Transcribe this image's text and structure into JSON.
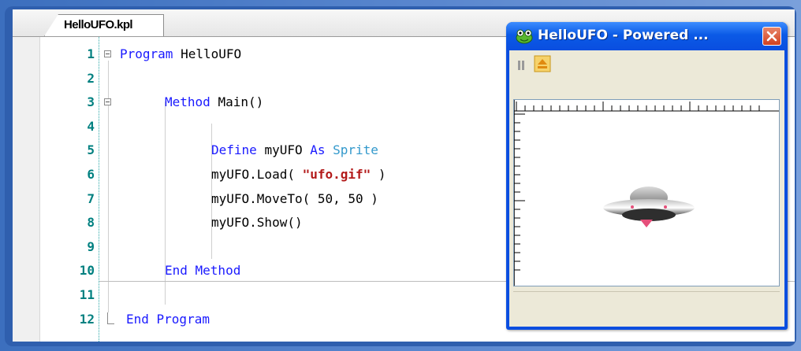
{
  "editor": {
    "tab_label": "HelloUFO.kpl",
    "lines": [
      {
        "num": "1",
        "tokens": [
          [
            "kw",
            "Program "
          ],
          [
            "tx",
            "HelloUFO"
          ]
        ]
      },
      {
        "num": "2",
        "tokens": []
      },
      {
        "num": "3",
        "tokens": [
          [
            "kw",
            "Method "
          ],
          [
            "tx",
            "Main()"
          ]
        ]
      },
      {
        "num": "4",
        "tokens": []
      },
      {
        "num": "5",
        "tokens": [
          [
            "kw",
            "Define "
          ],
          [
            "tx",
            "myUFO "
          ],
          [
            "kw",
            "As "
          ],
          [
            "ty",
            "Sprite"
          ]
        ]
      },
      {
        "num": "6",
        "tokens": [
          [
            "tx",
            "myUFO.Load( "
          ],
          [
            "str",
            "\"ufo.gif\""
          ],
          [
            "tx",
            " )"
          ]
        ]
      },
      {
        "num": "7",
        "tokens": [
          [
            "tx",
            "myUFO.MoveTo( 50, 50 )"
          ]
        ]
      },
      {
        "num": "8",
        "tokens": [
          [
            "tx",
            "myUFO.Show()"
          ]
        ]
      },
      {
        "num": "9",
        "tokens": []
      },
      {
        "num": "10",
        "tokens": [
          [
            "kw",
            "End Method"
          ]
        ]
      },
      {
        "num": "11",
        "tokens": []
      },
      {
        "num": "12",
        "tokens": [
          [
            "kw",
            "End Program"
          ]
        ]
      }
    ]
  },
  "window": {
    "title": "HelloUFO - Powered ...",
    "icons": [
      "frog-icon",
      "close-icon",
      "pause-icon",
      "eject-icon"
    ]
  },
  "colors": {
    "keyword": "#1a1aff",
    "string": "#b31a1a",
    "type": "#3399cc",
    "line_number": "#008080",
    "titlebar": "#0a4ee0"
  }
}
